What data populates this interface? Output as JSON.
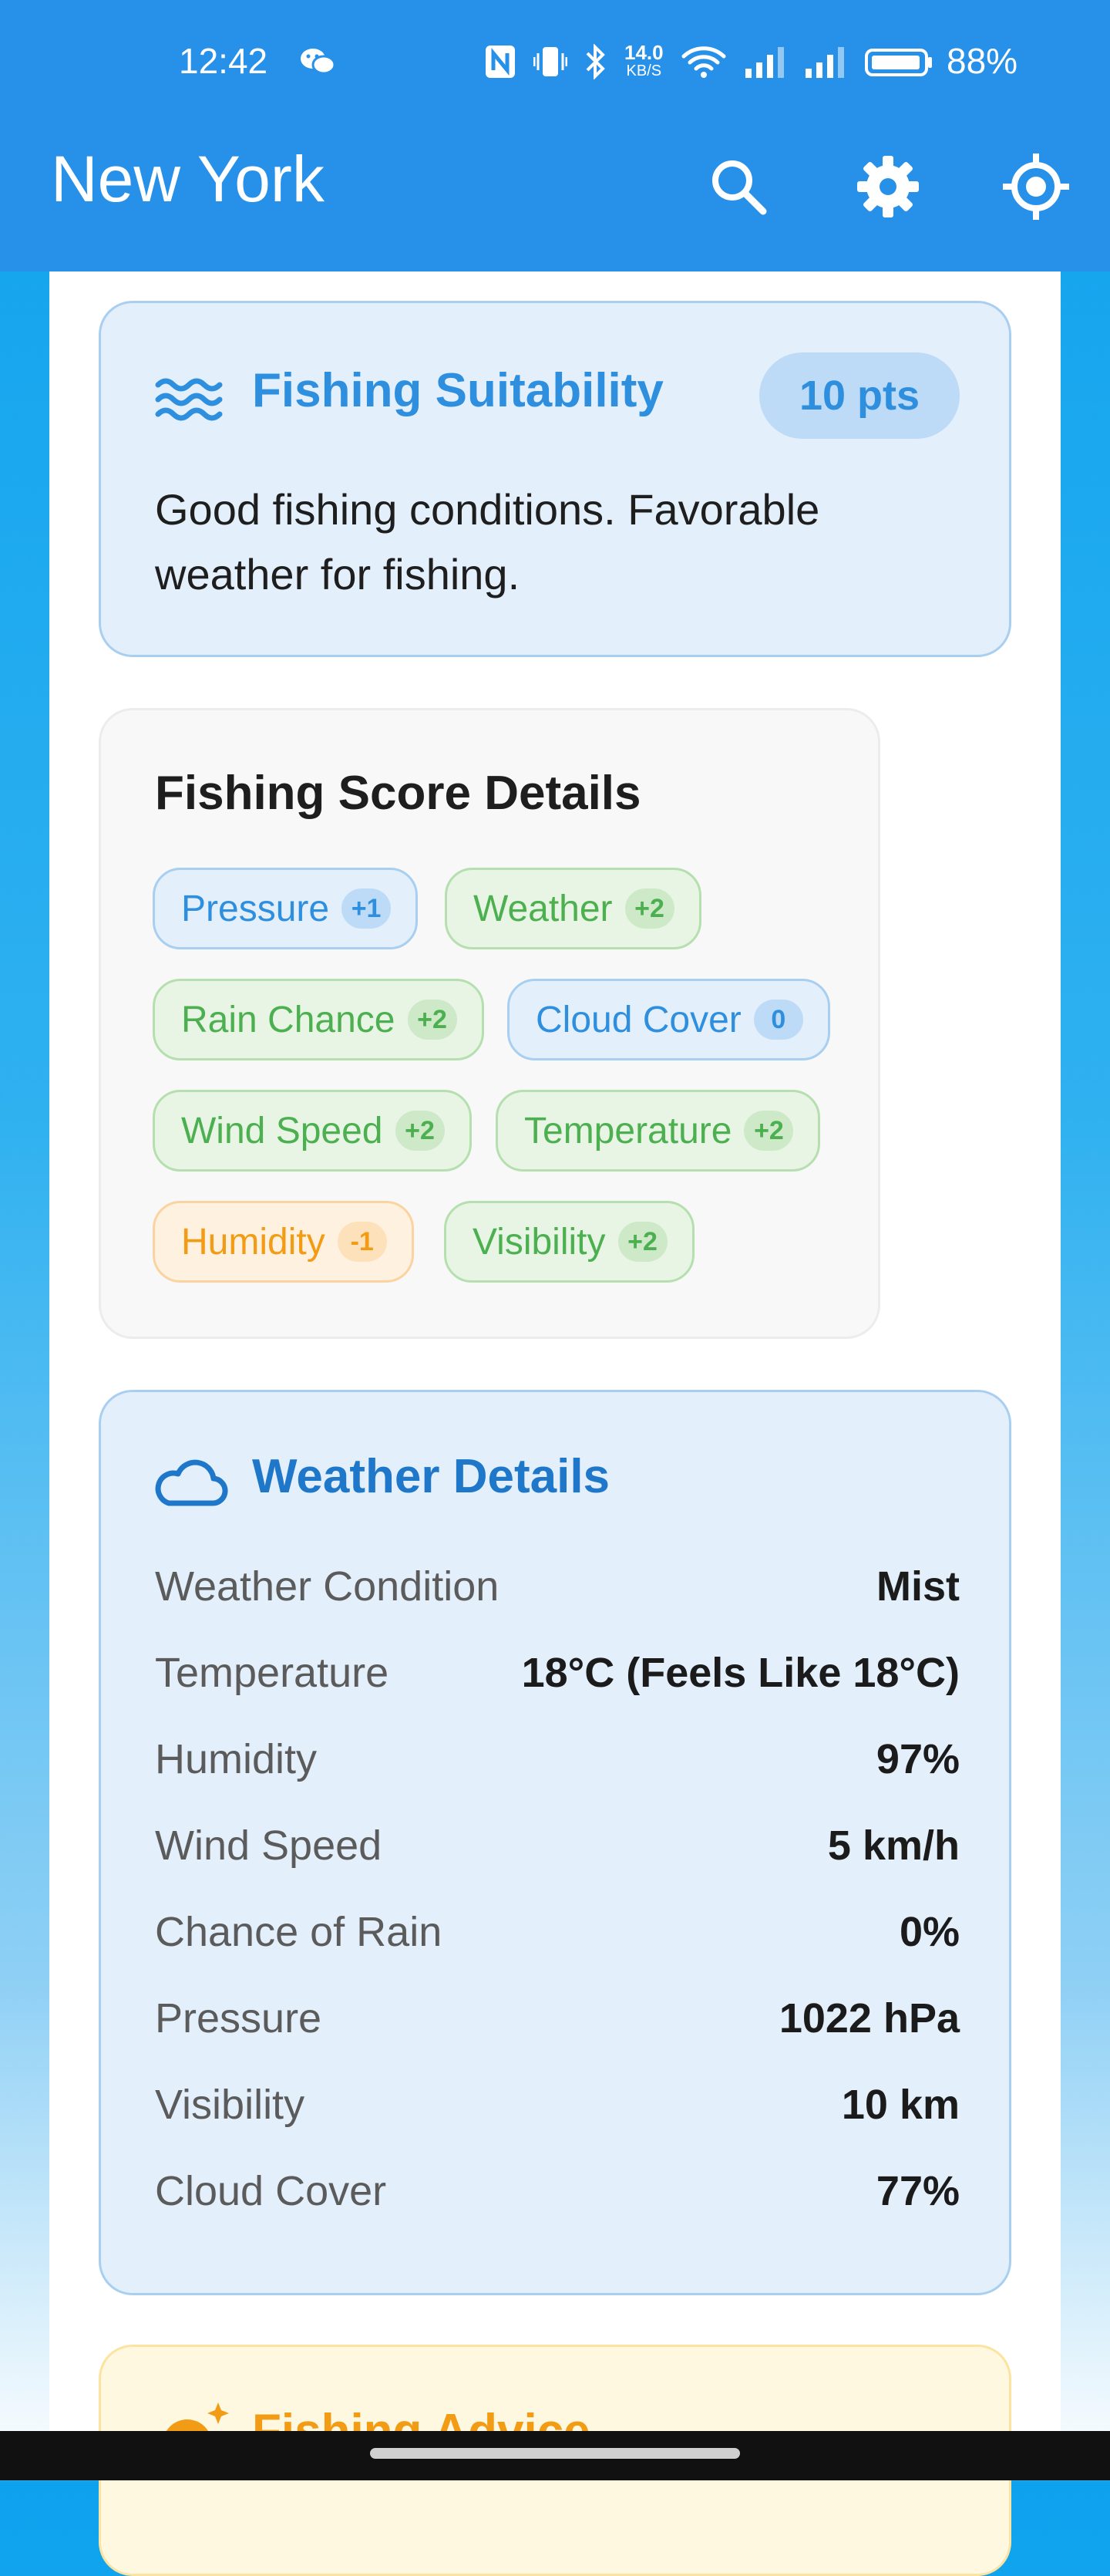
{
  "status_bar": {
    "time": "12:42",
    "net_speed_value": "14.0",
    "net_speed_unit": "KB/S",
    "battery_pct": "88%"
  },
  "app_bar": {
    "city": "New York"
  },
  "fishing_suitability": {
    "title": "Fishing Suitability",
    "points": "10 pts",
    "description": "Good fishing conditions. Favorable weather for fishing."
  },
  "score_details": {
    "title": "Fishing Score Details",
    "factors": [
      {
        "label": "Pressure",
        "score": "+1",
        "tone": "blue"
      },
      {
        "label": "Weather",
        "score": "+2",
        "tone": "green"
      },
      {
        "label": "Rain Chance",
        "score": "+2",
        "tone": "green"
      },
      {
        "label": "Cloud Cover",
        "score": "0",
        "tone": "blue"
      },
      {
        "label": "Wind Speed",
        "score": "+2",
        "tone": "green"
      },
      {
        "label": "Temperature",
        "score": "+2",
        "tone": "green"
      },
      {
        "label": "Humidity",
        "score": "-1",
        "tone": "orange"
      },
      {
        "label": "Visibility",
        "score": "+2",
        "tone": "green"
      }
    ]
  },
  "weather_details": {
    "title": "Weather Details",
    "rows": [
      {
        "label": "Weather Condition",
        "value": "Mist"
      },
      {
        "label": "Temperature",
        "value": "18°C (Feels Like 18°C)"
      },
      {
        "label": "Humidity",
        "value": "97%"
      },
      {
        "label": "Wind Speed",
        "value": "5 km/h"
      },
      {
        "label": "Chance of Rain",
        "value": "0%"
      },
      {
        "label": "Pressure",
        "value": "1022 hPa"
      },
      {
        "label": "Visibility",
        "value": "10 km"
      },
      {
        "label": "Cloud Cover",
        "value": "77%"
      }
    ]
  },
  "fishing_advice": {
    "title": "Fishing Advice"
  },
  "colors": {
    "app_bar": "#2790e9",
    "accent_blue": "#2f8fdf",
    "accent_green": "#4caf50",
    "accent_orange": "#f29b14"
  }
}
